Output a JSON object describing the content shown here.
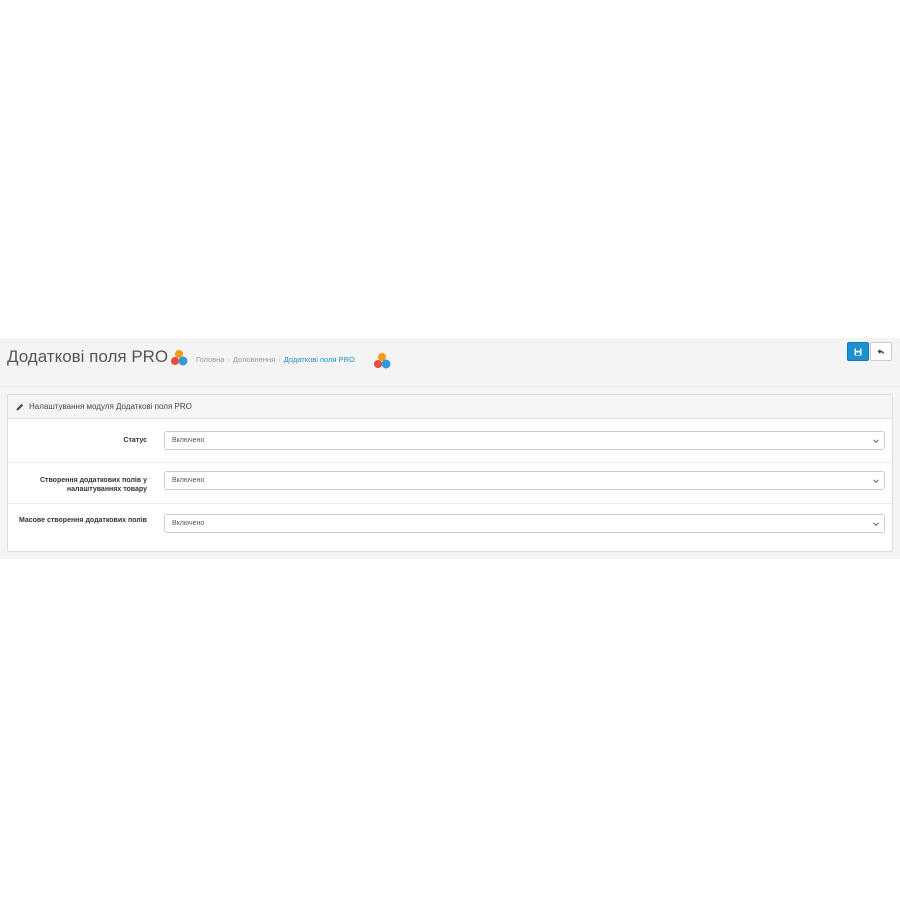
{
  "header": {
    "title": "Додаткові поля PRO",
    "breadcrumbs": [
      {
        "label": "Головна",
        "active": false
      },
      {
        "label": "Доповнення",
        "active": false
      },
      {
        "label": "Додаткові поля PRO",
        "active": true
      }
    ],
    "breadcrumb_separator": "›",
    "save_button_icon": "save-icon",
    "back_button_icon": "reply-icon"
  },
  "panel": {
    "title": "Налаштування модуля Додаткові поля PRO",
    "title_icon": "pencil-icon"
  },
  "form": {
    "fields": [
      {
        "label": "Статус",
        "value": "Включено"
      },
      {
        "label": "Створення додаткових полів у налаштуваннях товару",
        "value": "Включено"
      },
      {
        "label": "Масове створення додаткових полів",
        "value": "Включено"
      }
    ]
  },
  "colors": {
    "primary": "#1e91cf",
    "logo_orange": "#f39c12",
    "logo_red": "#e74c3c",
    "logo_blue": "#3498db"
  }
}
